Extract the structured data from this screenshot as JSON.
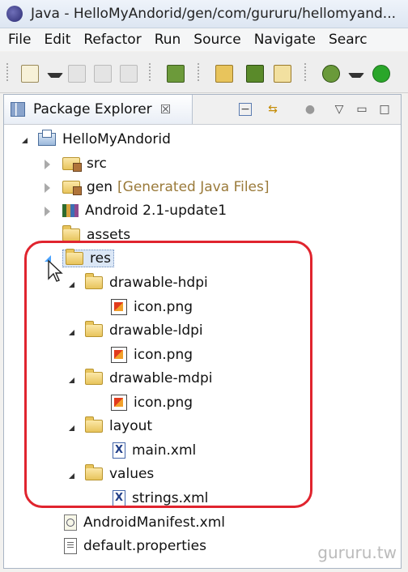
{
  "window": {
    "title": "Java - HelloMyAndorid/gen/com/gururu/hellomyand..."
  },
  "menu": [
    "File",
    "Edit",
    "Refactor",
    "Run",
    "Source",
    "Navigate",
    "Searc"
  ],
  "panel": {
    "tab_label": "Package Explorer",
    "close_glyph": "☒"
  },
  "tree": {
    "project": "HelloMyAndorid",
    "src": "src",
    "gen": "gen",
    "gen_decoration": "[Generated Java Files]",
    "library": "Android 2.1-update1",
    "assets": "assets",
    "res": "res",
    "drawable_hdpi": "drawable-hdpi",
    "drawable_ldpi": "drawable-ldpi",
    "drawable_mdpi": "drawable-mdpi",
    "icon_png": "icon.png",
    "layout": "layout",
    "main_xml": "main.xml",
    "values": "values",
    "strings_xml": "strings.xml",
    "manifest": "AndroidManifest.xml",
    "default_properties": "default.properties"
  },
  "watermark": "gururu.tw"
}
